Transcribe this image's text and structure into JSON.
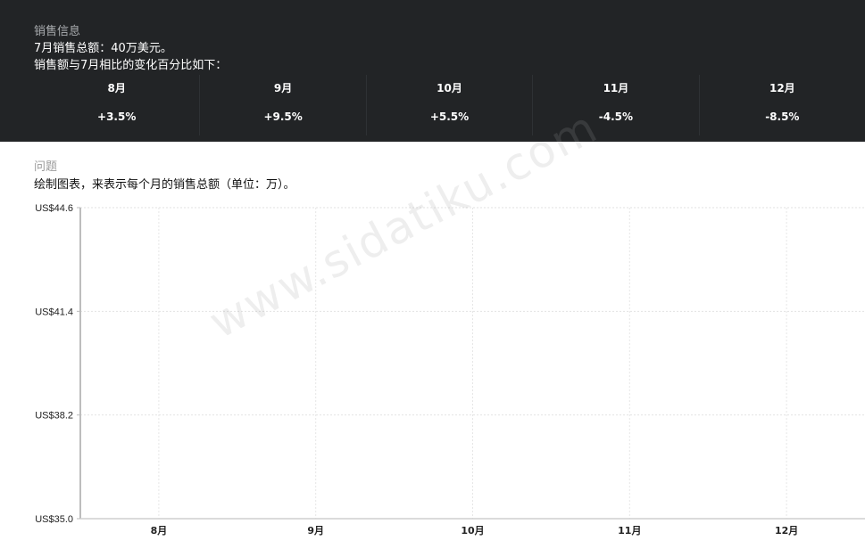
{
  "info": {
    "heading": "销售信息",
    "line1": "7月销售总额：40万美元。",
    "line2": "销售额与7月相比的变化百分比如下：",
    "changes": [
      {
        "month": "8月",
        "pct": "+3.5%"
      },
      {
        "month": "9月",
        "pct": "+9.5%"
      },
      {
        "month": "10月",
        "pct": "+5.5%"
      },
      {
        "month": "11月",
        "pct": "-4.5%"
      },
      {
        "month": "12月",
        "pct": "-8.5%"
      }
    ]
  },
  "question": {
    "heading": "问题",
    "text": "绘制图表，来表示每个月的销售总额（单位：万）。"
  },
  "watermark": "www.sidatiku.com",
  "chart_data": {
    "type": "bar",
    "categories": [
      "8月",
      "9月",
      "10月",
      "11月",
      "12月"
    ],
    "values": [],
    "y_tick_labels": [
      "US$35.0",
      "US$38.2",
      "US$41.4",
      "US$44.6"
    ],
    "y_tick_values": [
      35.0,
      38.2,
      41.4,
      44.6
    ],
    "ylim": [
      35.0,
      44.6
    ],
    "grid": true,
    "title": "",
    "xlabel": "",
    "ylabel": ""
  }
}
